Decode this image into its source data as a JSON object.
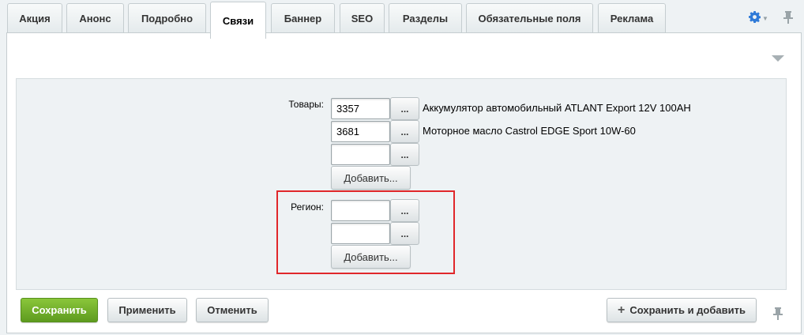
{
  "tabs": [
    {
      "label": "Акция"
    },
    {
      "label": "Анонс"
    },
    {
      "label": "Подробно"
    },
    {
      "label": "Связи"
    },
    {
      "label": "Баннер"
    },
    {
      "label": "SEO"
    },
    {
      "label": "Разделы"
    },
    {
      "label": "Обязательные поля"
    },
    {
      "label": "Реклама"
    }
  ],
  "active_tab": "Связи",
  "form": {
    "products": {
      "label": "Товары:",
      "rows": [
        {
          "value": "3357",
          "name": "Аккумулятор автомобильный ATLANT Export 12V 100AH"
        },
        {
          "value": "3681",
          "name": "Моторное масло Castrol EDGE Sport 10W-60"
        },
        {
          "value": "",
          "name": ""
        }
      ],
      "browse_label": "...",
      "add_label": "Добавить..."
    },
    "region": {
      "label": "Регион:",
      "rows": [
        {
          "value": ""
        },
        {
          "value": ""
        }
      ],
      "browse_label": "...",
      "add_label": "Добавить..."
    }
  },
  "footer": {
    "save": "Сохранить",
    "apply": "Применить",
    "cancel": "Отменить",
    "save_and_add": "Сохранить и добавить"
  },
  "colors": {
    "accent": "#2f7ad8",
    "save_green": "#6aa82a",
    "highlight_red": "#e0272a"
  },
  "icons": [
    "gear-icon",
    "pin-icon",
    "collapse-arrow-icon",
    "plus-icon"
  ]
}
